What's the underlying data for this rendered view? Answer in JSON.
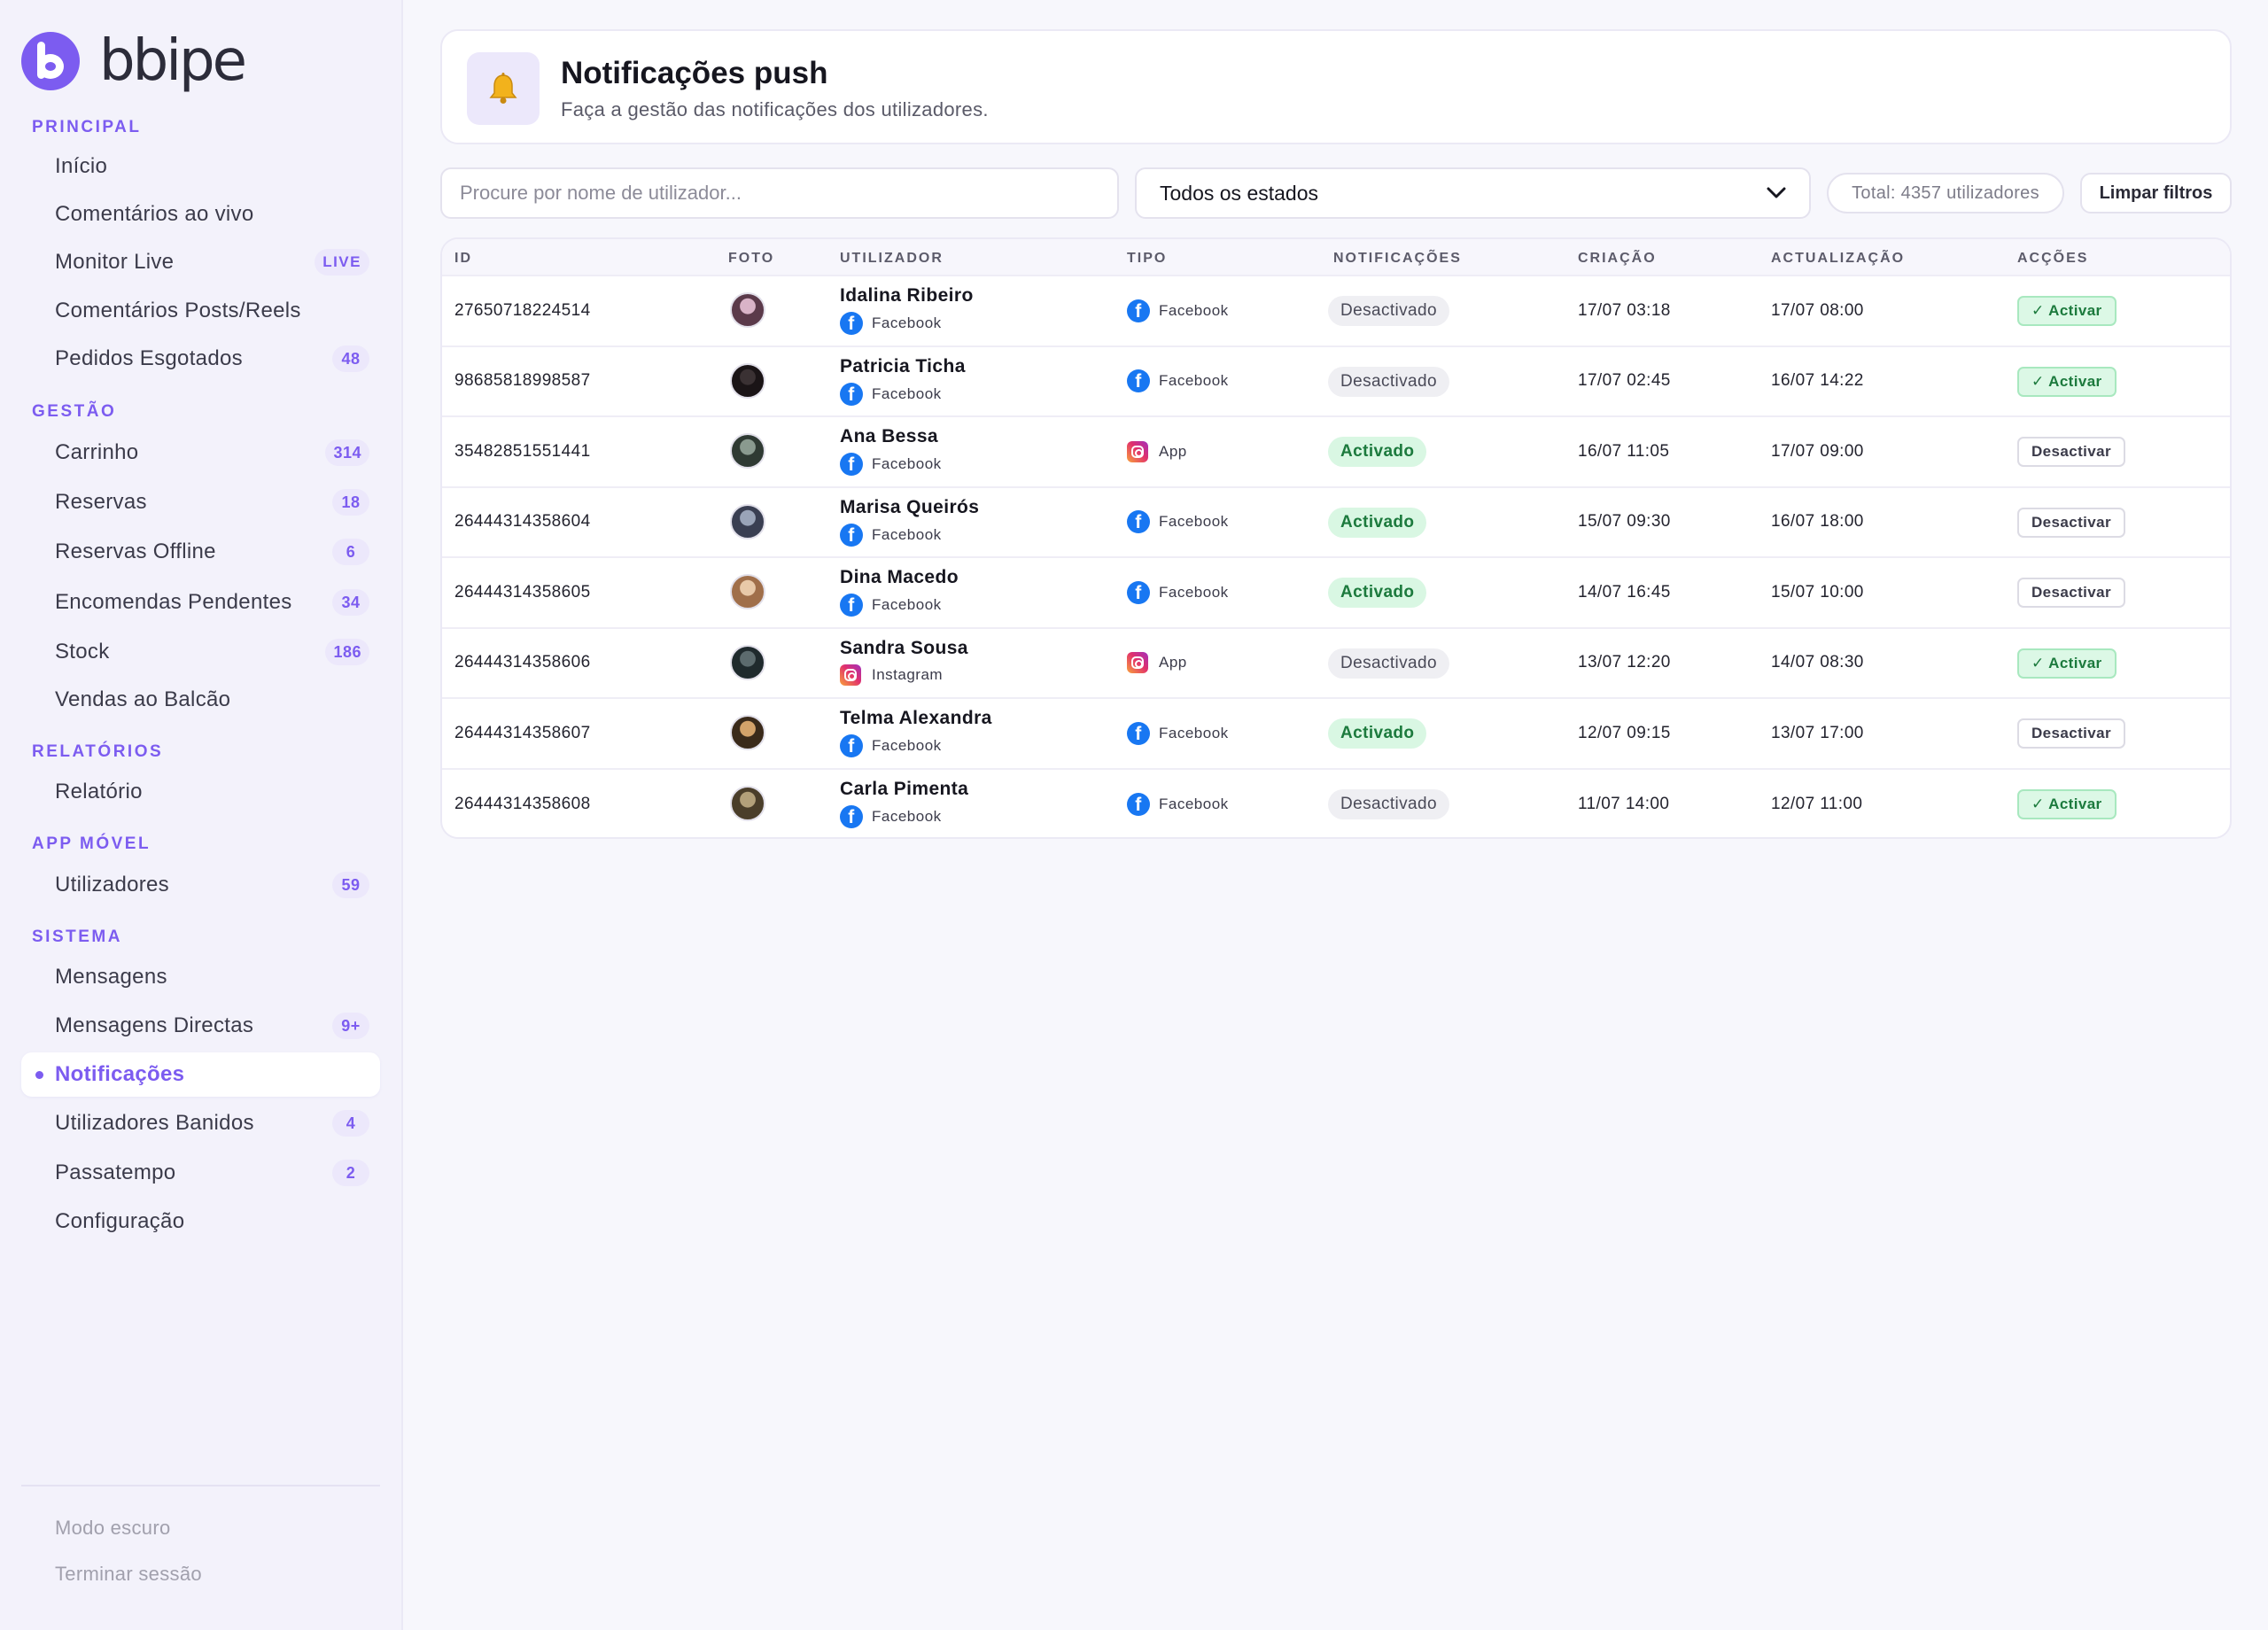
{
  "brand": {
    "name": "bbipe"
  },
  "sidebar": {
    "sections": [
      {
        "title": "PRINCIPAL"
      },
      {
        "title": "GESTÃO"
      },
      {
        "title": "RELATÓRIOS"
      },
      {
        "title": "APP MÓVEL"
      },
      {
        "title": "SISTEMA"
      }
    ],
    "items": [
      {
        "label": "Início",
        "badge": ""
      },
      {
        "label": "Comentários ao vivo",
        "badge": ""
      },
      {
        "label": "Monitor Live",
        "badge": "LIVE"
      },
      {
        "label": "Comentários Posts/Reels",
        "badge": ""
      },
      {
        "label": "Pedidos Esgotados",
        "badge": "48"
      },
      {
        "label": "Carrinho",
        "badge": "314"
      },
      {
        "label": "Reservas",
        "badge": "18"
      },
      {
        "label": "Reservas Offline",
        "badge": "6"
      },
      {
        "label": "Encomendas Pendentes",
        "badge": "34"
      },
      {
        "label": "Stock",
        "badge": "186"
      },
      {
        "label": "Vendas ao Balcão",
        "badge": ""
      },
      {
        "label": "Relatório",
        "badge": ""
      },
      {
        "label": "Utilizadores",
        "badge": "59"
      },
      {
        "label": "Mensagens",
        "badge": ""
      },
      {
        "label": "Mensagens Directas",
        "badge": "9+"
      },
      {
        "label": "Notificações",
        "badge": "",
        "active": true
      },
      {
        "label": "Utilizadores Banidos",
        "badge": "4"
      },
      {
        "label": "Passatempo",
        "badge": "2"
      },
      {
        "label": "Configuração",
        "badge": ""
      }
    ],
    "footer": {
      "dark_mode": "Modo escuro",
      "logout": "Terminar sessão"
    }
  },
  "header": {
    "title": "Notificações push",
    "subtitle": "Faça a gestão das notificações dos utilizadores.",
    "icon": "bell-icon"
  },
  "filters": {
    "search_placeholder": "Procure por nome de utilizador...",
    "status_selected": "Todos os estados",
    "total": "Total: 4357 utilizadores",
    "clear_label": "Limpar filtros"
  },
  "table": {
    "columns": [
      "ID",
      "FOTO",
      "UTILIZADOR",
      "TIPO",
      "NOTIFICAÇÕES",
      "CRIAÇÃO",
      "ACTUALIZAÇÃO",
      "ACÇÕES"
    ],
    "rows": [
      {
        "id": "27650718224514",
        "name": "Idalina Ribeiro",
        "source": "Facebook",
        "type": "Facebook",
        "status": "Desactivado",
        "created": "17/07 03:18",
        "updated": "17/07 08:00",
        "action": "✓ Activar"
      },
      {
        "id": "98685818998587",
        "name": "Patricia Ticha",
        "source": "Facebook",
        "type": "Facebook",
        "status": "Desactivado",
        "created": "17/07 02:45",
        "updated": "16/07 14:22",
        "action": "✓ Activar"
      },
      {
        "id": "35482851551441",
        "name": "Ana Bessa",
        "source": "Facebook",
        "type": "App",
        "status": "Activado",
        "created": "16/07 11:05",
        "updated": "17/07 09:00",
        "action": "Desactivar"
      },
      {
        "id": "26444314358604",
        "name": "Marisa Queirós",
        "source": "Facebook",
        "type": "Facebook",
        "status": "Activado",
        "created": "15/07 09:30",
        "updated": "16/07 18:00",
        "action": "Desactivar"
      },
      {
        "id": "26444314358605",
        "name": "Dina Macedo",
        "source": "Facebook",
        "type": "Facebook",
        "status": "Activado",
        "created": "14/07 16:45",
        "updated": "15/07 10:00",
        "action": "Desactivar"
      },
      {
        "id": "26444314358606",
        "name": "Sandra Sousa",
        "source": "Instagram",
        "type": "App",
        "status": "Desactivado",
        "created": "13/07 12:20",
        "updated": "14/07 08:30",
        "action": "✓ Activar"
      },
      {
        "id": "26444314358607",
        "name": "Telma Alexandra",
        "source": "Facebook",
        "type": "Facebook",
        "status": "Activado",
        "created": "12/07 09:15",
        "updated": "13/07 17:00",
        "action": "Desactivar"
      },
      {
        "id": "26444314358608",
        "name": "Carla Pimenta",
        "source": "Facebook",
        "type": "Facebook",
        "status": "Desactivado",
        "created": "11/07 14:00",
        "updated": "12/07 11:00",
        "action": "✓ Activar"
      }
    ]
  },
  "colors": {
    "accent": "#7c5cf0",
    "success": "#1c7a3d",
    "facebook": "#1877f2"
  }
}
